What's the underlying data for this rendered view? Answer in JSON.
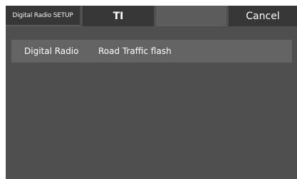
{
  "header": {
    "title": "Digital Radio SETUP",
    "center_label": "TI",
    "blank_label": "",
    "cancel_label": "Cancel"
  },
  "settings": [
    {
      "label": "Digital Radio",
      "value": "Road Traffic flash"
    }
  ]
}
